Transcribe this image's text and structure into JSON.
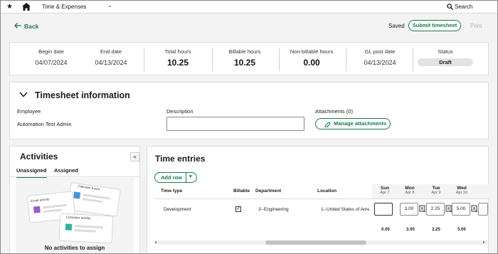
{
  "topnav": {
    "module": "Time & Expenses",
    "search_label": "Search"
  },
  "header": {
    "back_label": "Back",
    "saved_label": "Saved",
    "submit_label": "Submit timesheet",
    "print_label": "Print"
  },
  "summary": {
    "begin_date": {
      "label": "Begin date",
      "value": "04/07/2024"
    },
    "end_date": {
      "label": "End date",
      "value": "04/13/2024"
    },
    "total_hours": {
      "label": "Total hours",
      "value": "10.25"
    },
    "billable_hours": {
      "label": "Billable hours",
      "value": "10.25"
    },
    "nonbillable_hours": {
      "label": "Non-billable hours",
      "value": "0.00"
    },
    "gl_post_date": {
      "label": "GL post date",
      "value": "04/13/2024"
    },
    "status": {
      "label": "Status",
      "value": "Draft"
    }
  },
  "timesheet_info": {
    "title": "Timesheet information",
    "employee_label": "Employee",
    "employee_value": "Automation Test Admin",
    "description_label": "Description",
    "description_value": "",
    "attachments_label": "Attachments (0)",
    "manage_label": "Manage attachments"
  },
  "activities": {
    "title": "Activities",
    "tabs": [
      "Unassigned",
      "Assigned"
    ],
    "illus_labels": [
      "Calendar Event",
      "Email activity",
      "Computer activity"
    ],
    "empty_message": "No activities to assign"
  },
  "entries": {
    "title": "Time entries",
    "add_row_label": "Add row",
    "columns": [
      "Time type",
      "Billable",
      "Department",
      "Location"
    ],
    "days": [
      {
        "name": "Sun",
        "date": "Apr 7"
      },
      {
        "name": "Mon",
        "date": "Apr 8"
      },
      {
        "name": "Tue",
        "date": "Apr 9"
      },
      {
        "name": "Wed",
        "date": "Apr 10"
      }
    ],
    "rows": [
      {
        "time_type": "Development",
        "billable": true,
        "department": "3--Engineering",
        "location": "1--United States of Ame",
        "hours": [
          "",
          "3.00",
          "2.25",
          "5.00"
        ]
      }
    ],
    "totals": [
      "0.00",
      "3.00",
      "2.25",
      "5.00"
    ]
  }
}
